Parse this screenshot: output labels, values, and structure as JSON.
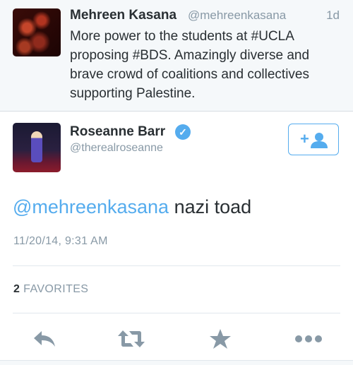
{
  "parent_tweet": {
    "author_name": "Mehreen Kasana",
    "author_handle": "@mehreenkasana",
    "time": "1d",
    "text": "More power to the students at #UCLA proposing #BDS. Amazingly diverse and brave crowd of coalitions and collectives supporting Palestine."
  },
  "main_tweet": {
    "author_name": "Roseanne Barr",
    "author_handle": "@therealroseanne",
    "verified": true,
    "mention": "@mehreenkasana",
    "text": "nazi toad",
    "timestamp": "11/20/14, 9:31 AM",
    "favorites_count": "2",
    "favorites_label": "FAVORITES"
  },
  "icons": {
    "verified": "verified-badge-icon",
    "follow": "follow-user-icon",
    "reply": "reply-icon",
    "retweet": "retweet-icon",
    "favorite": "favorite-star-icon",
    "more": "more-options-icon"
  },
  "colors": {
    "accent": "#55acee",
    "muted": "#8899a6",
    "text": "#292f33",
    "action_icon": "#8899a6"
  }
}
